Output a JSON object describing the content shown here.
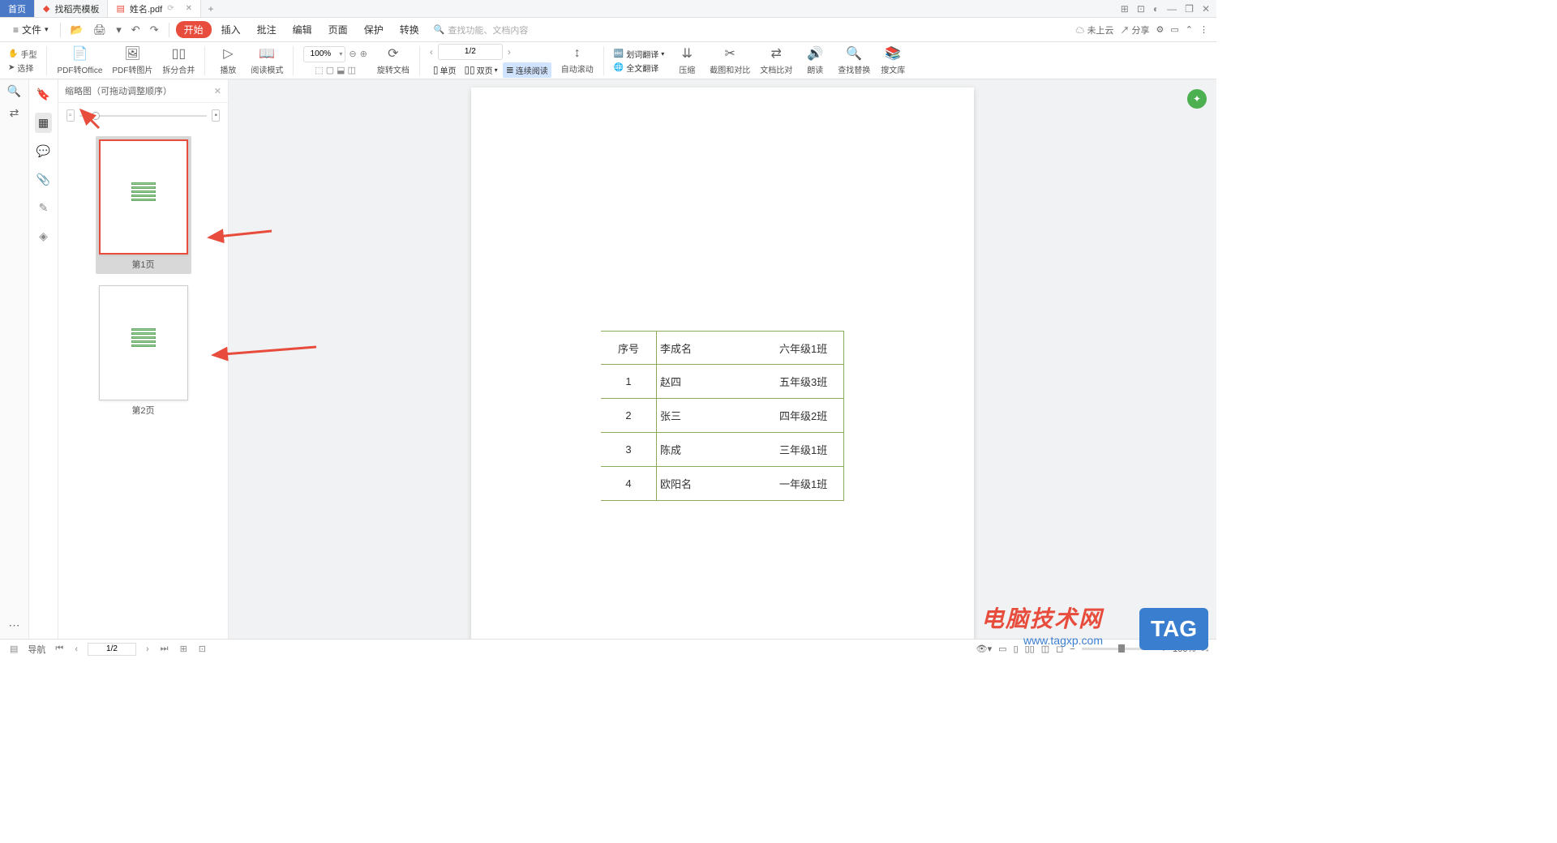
{
  "tabs": {
    "home": "首页",
    "template": "找稻壳模板",
    "file": "姓名.pdf",
    "new_tab_tooltip": "+"
  },
  "window_controls": {
    "layout": "⊞",
    "apps": "⊡",
    "account": "◐",
    "min": "—",
    "restore": "❐",
    "close": "✕"
  },
  "menu": {
    "file": "文件",
    "tabs": [
      "开始",
      "插入",
      "批注",
      "编辑",
      "页面",
      "保护",
      "转换"
    ],
    "active_tab": "开始",
    "search_placeholder": "查找功能、文档内容",
    "right": {
      "cloud": "未上云",
      "share": "分享"
    }
  },
  "ribbon_left": {
    "hand": "手型",
    "select": "选择"
  },
  "ribbon": {
    "pdf_to_office": "PDF转Office",
    "pdf_to_image": "PDF转图片",
    "split_merge": "拆分合并",
    "play": "播放",
    "reading_mode": "阅读模式",
    "zoom_value": "100%",
    "page_display": "1/2",
    "rotate": "旋转文档",
    "single_page": "单页",
    "double_page": "双页",
    "continuous": "连续阅读",
    "auto_scroll": "自动滚动",
    "word_translate": "划词翻译",
    "full_translate": "全文翻译",
    "compress": "压缩",
    "screenshot_compare": "截图和对比",
    "text_compare": "文档比对",
    "read_aloud": "朗读",
    "find_replace": "查找替换",
    "search_lib": "搜文库"
  },
  "thumbnail": {
    "title": "缩略图（可拖动调整顺序）",
    "page1": "第1页",
    "page2": "第2页"
  },
  "document": {
    "header": {
      "col1": "序号",
      "name": "李成名",
      "class": "六年级1班"
    },
    "rows": [
      {
        "num": "1",
        "name": "赵四",
        "class": "五年级3班"
      },
      {
        "num": "2",
        "name": "张三",
        "class": "四年级2班"
      },
      {
        "num": "3",
        "name": "陈成",
        "class": "三年级1班"
      },
      {
        "num": "4",
        "name": "欧阳名",
        "class": "一年级1班"
      }
    ]
  },
  "status": {
    "nav_label": "导航",
    "page": "1/2",
    "zoom": "100%"
  },
  "watermark": {
    "brand": "电脑技术网",
    "url": "www.tagxp.com",
    "tag": "TAG"
  }
}
